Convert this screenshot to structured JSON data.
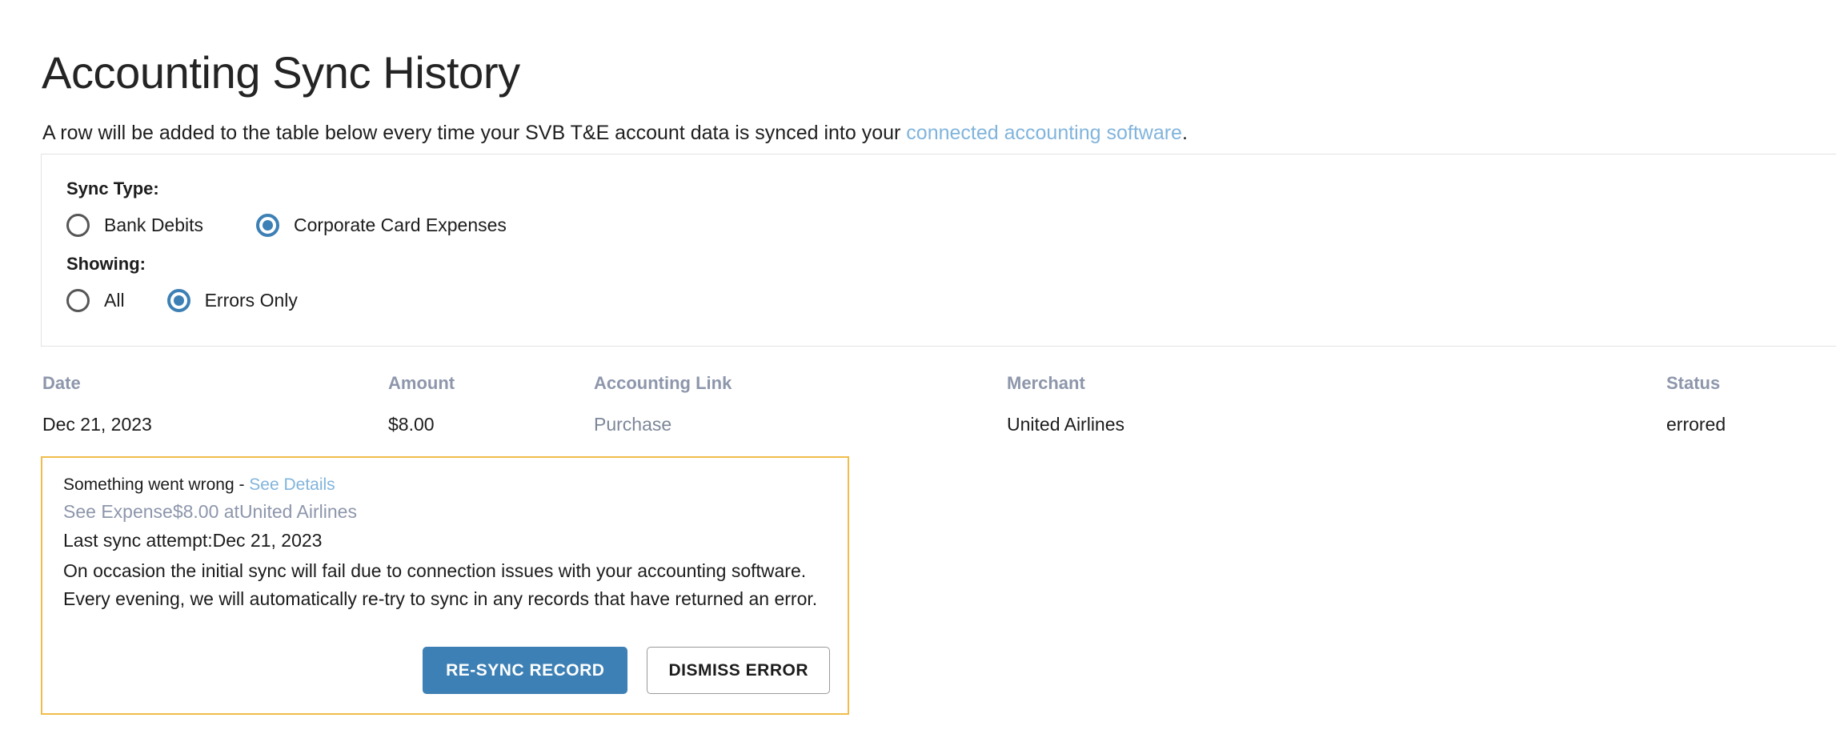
{
  "header": {
    "title": "Accounting Sync History",
    "subtitle_before": "A row will be added to the table below every time your SVB T&E account data is synced into your ",
    "subtitle_link": "connected accounting software",
    "subtitle_after": "."
  },
  "filters": {
    "sync_type_label": "Sync Type:",
    "sync_type_options": [
      {
        "label": "Bank Debits",
        "selected": false
      },
      {
        "label": "Corporate Card Expenses",
        "selected": true
      }
    ],
    "showing_label": "Showing:",
    "showing_options": [
      {
        "label": "All",
        "selected": false
      },
      {
        "label": "Errors Only",
        "selected": true
      }
    ]
  },
  "table": {
    "columns": [
      "Date",
      "Amount",
      "Accounting Link",
      "Merchant",
      "Status"
    ],
    "rows": [
      {
        "date": "Dec 21, 2023",
        "amount": "$8.00",
        "accounting_link": "Purchase",
        "merchant": "United Airlines",
        "status": "errored"
      }
    ]
  },
  "error_callout": {
    "headline": "Something went wrong - ",
    "see_details_label": "See Details",
    "expense_line": "See Expense$8.00 atUnited Airlines",
    "last_sync_line": "Last sync attempt:Dec 21, 2023",
    "body": "On occasion the initial sync will fail due to connection issues with your accounting software. Every evening, we will automatically re-try to sync in any records that have returned an error.",
    "resync_label": "RE-SYNC RECORD",
    "dismiss_label": "DISMISS ERROR"
  },
  "colors": {
    "link_blue": "#81b4dc",
    "primary_blue": "#3d80b5",
    "header_gray": "#8d96ab",
    "warning_border": "#f0bd4a",
    "card_border": "#e3e3e3"
  }
}
